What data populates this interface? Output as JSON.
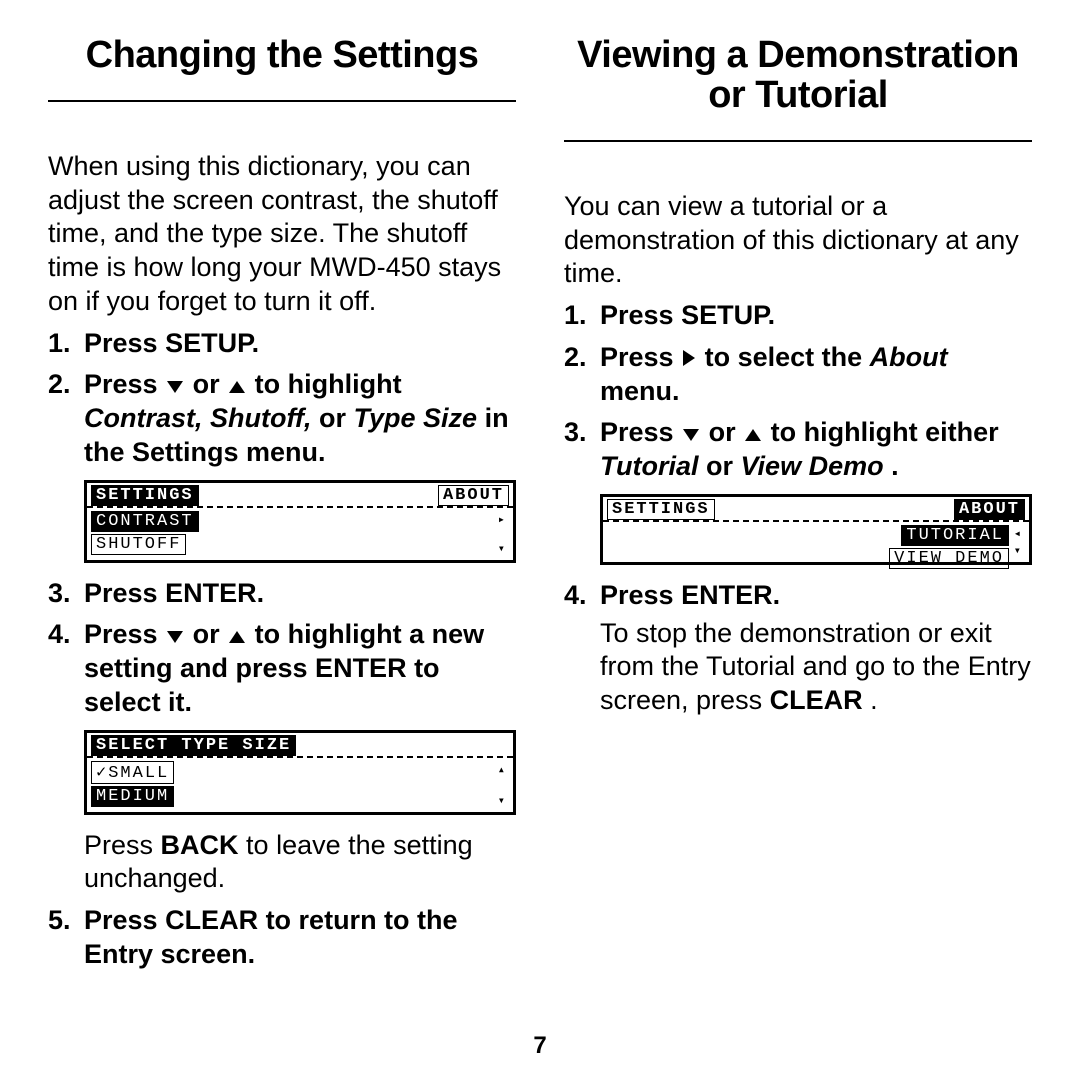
{
  "page_number": "7",
  "left": {
    "heading": "Changing the Settings",
    "intro": "When using this dictionary, you can adjust the screen contrast, the shutoff time, and the type size. The shutoff time is how long your MWD-450 stays on if you forget to turn it off.",
    "steps": {
      "s1": "Press SETUP.",
      "s2_a": "Press ",
      "s2_b": " or ",
      "s2_c": " to highlight ",
      "s2_items": "Contrast, Shutoff,",
      "s2_or": " or ",
      "s2_last": "Type Size",
      "s2_end": " in the Settings menu.",
      "s3": "Press ENTER.",
      "s4_a": "Press ",
      "s4_b": " or ",
      "s4_c": " to highlight a new setting and press ENTER to select it.",
      "s4_sub_a": "Press ",
      "s4_sub_b": "BACK",
      "s4_sub_c": " to leave the setting unchanged.",
      "s5": "Press CLEAR to return to the Entry screen."
    },
    "lcd1": {
      "tab_left": "SETTINGS",
      "tab_right": "ABOUT",
      "row1": "CONTRAST",
      "row2": "SHUTOFF"
    },
    "lcd2": {
      "title": "SELECT TYPE SIZE",
      "row1": "✓SMALL",
      "row2": "MEDIUM"
    }
  },
  "right": {
    "heading_l1": "Viewing a Demonstration",
    "heading_l2": "or Tutorial",
    "intro": "You can view a tutorial or a demonstration of this dictionary at any time.",
    "steps": {
      "s1": "Press SETUP.",
      "s2_a": "Press ",
      "s2_b": " to select the ",
      "s2_c": "About",
      "s2_d": " menu.",
      "s3_a": "Press ",
      "s3_b": " or ",
      "s3_c": " to highlight either ",
      "s3_d": "Tutorial",
      "s3_e": " or ",
      "s3_f": "View Demo",
      "s3_g": ".",
      "s4": "Press ENTER.",
      "s4_sub_a": "To stop the demonstration or exit from the Tutorial and go to the Entry screen, press ",
      "s4_sub_b": "CLEAR",
      "s4_sub_c": "."
    },
    "lcd": {
      "tab_left": "SETTINGS",
      "tab_right": "ABOUT",
      "row1": "TUTORIAL",
      "row2": "VIEW DEMO"
    }
  }
}
